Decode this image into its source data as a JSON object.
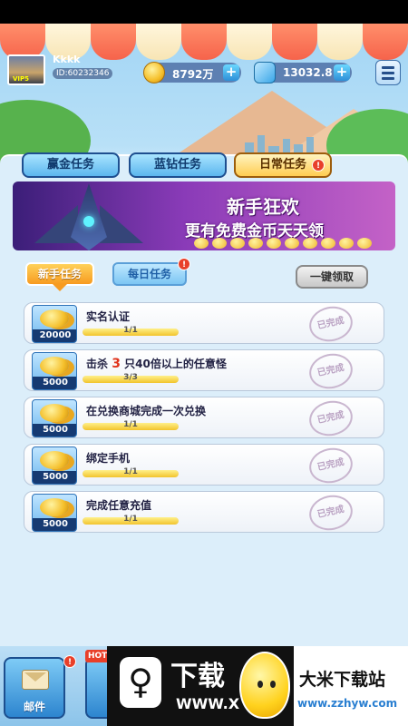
{
  "header": {
    "username": "Kkkk",
    "user_id": "ID:60232346",
    "avatar_tag": "VIP5",
    "gold_amount": "8792万",
    "diamond_amount": "13032.8",
    "add_symbol": "+"
  },
  "top_tabs": [
    {
      "label": "赢金任务"
    },
    {
      "label": "蓝钻任务"
    },
    {
      "label": "日常任务",
      "alert": "!"
    }
  ],
  "banner": {
    "title": "新手狂欢",
    "subtitle": "更有免费金币天天领"
  },
  "sub_tabs": [
    {
      "label": "新手任务"
    },
    {
      "label": "每日任务",
      "alert": "!"
    }
  ],
  "claim_all_label": "一键领取",
  "tasks": [
    {
      "reward": "20000",
      "title": "实名认证",
      "progress": "1/1",
      "progress_fraction": 1,
      "status": "已完成"
    },
    {
      "reward": "5000",
      "title_prefix": "击杀",
      "title_highlight": "3",
      "title_suffix": "只40倍以上的任意怪",
      "progress": "3/3",
      "progress_fraction": 1,
      "status": "已完成"
    },
    {
      "reward": "5000",
      "title": "在兑换商城完成一次兑换",
      "progress": "1/1",
      "progress_fraction": 1,
      "status": "已完成"
    },
    {
      "reward": "5000",
      "title": "绑定手机",
      "progress": "1/1",
      "progress_fraction": 1,
      "status": "已完成"
    },
    {
      "reward": "5000",
      "title": "完成任意充值",
      "progress": "1/1",
      "progress_fraction": 1,
      "status": "已完成"
    }
  ],
  "bottom": {
    "mail_label": "邮件",
    "mail_alert": "!",
    "hot_tag": "HOT"
  },
  "watermark": {
    "logo_char": "♀",
    "big_text": "下载",
    "url_text": "WWW.X",
    "site_name": "大米下载站",
    "site_url": "www.zzhyw.com"
  },
  "colors": {
    "active_tab": "#ffcd52",
    "tab_blue": "#5cb6ee",
    "banner_purple": "#8a3bb8",
    "alert_red": "#e8402a"
  }
}
